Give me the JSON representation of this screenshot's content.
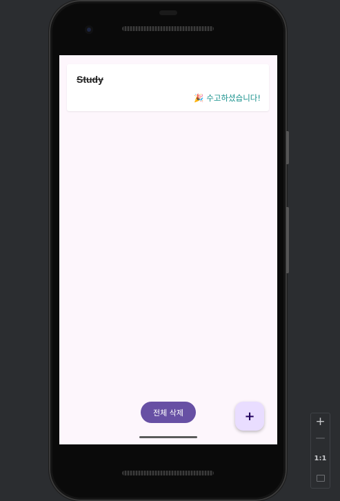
{
  "card": {
    "title": "Study",
    "status": "🎉 수고하셨습니다!"
  },
  "actions": {
    "delete_all_label": "전체 삭제",
    "add_label": "+"
  },
  "zoom": {
    "in_icon": "+",
    "out_icon": "—",
    "ratio_label": "1:1"
  },
  "colors": {
    "screen_bg": "#fdf6fc",
    "primary": "#6750a4",
    "fab_bg": "#e9ddff",
    "status_text": "#138f8a"
  }
}
